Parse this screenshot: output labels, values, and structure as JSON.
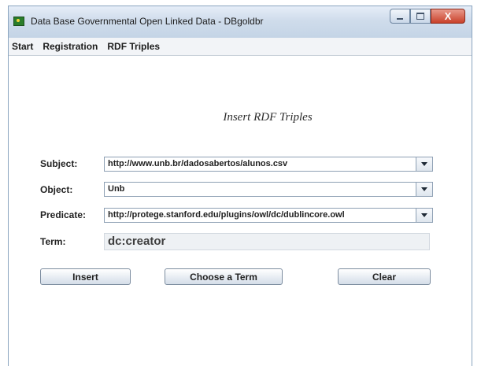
{
  "window": {
    "title": "Data Base Governmental Open Linked Data - DBgoldbr",
    "controls": {
      "minimize_icon": "minimize-icon",
      "maximize_icon": "maximize-icon",
      "close_icon": "close-icon",
      "close_glyph": "X"
    }
  },
  "menu": {
    "items": [
      {
        "label": "Start"
      },
      {
        "label": "Registration"
      },
      {
        "label": "RDF Triples"
      }
    ]
  },
  "form": {
    "title": "Insert RDF Triples",
    "subject": {
      "label": "Subject:",
      "value": "http://www.unb.br/dadosabertos/alunos.csv"
    },
    "object": {
      "label": "Object:",
      "value": "Unb"
    },
    "predicate": {
      "label": "Predicate:",
      "value": "http://protege.stanford.edu/plugins/owl/dc/dublincore.owl"
    },
    "term": {
      "label": "Term:",
      "value": "dc:creator"
    },
    "buttons": {
      "insert": "Insert",
      "choose_term": "Choose a Term",
      "clear": "Clear"
    }
  },
  "colors": {
    "titlebar": "#cfdceb",
    "close_button": "#c9412a",
    "window_border": "#8aa4bf"
  }
}
